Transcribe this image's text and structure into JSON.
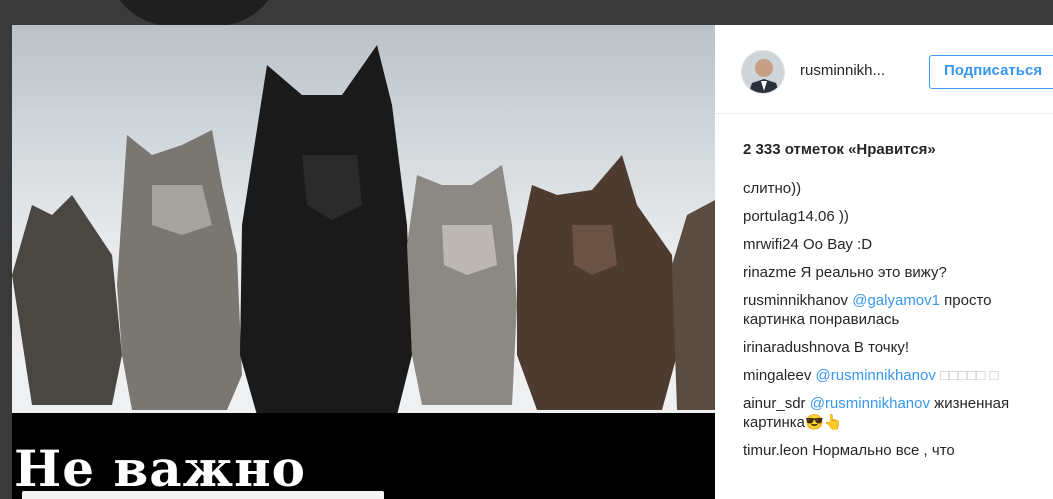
{
  "post": {
    "caption_overlay": "Не важно"
  },
  "header": {
    "username": "rusminnikh...",
    "follow_label": "Подписаться"
  },
  "likes_text": "2 333 отметок «Нравится»",
  "comments": [
    {
      "user": "",
      "text": "слитно))",
      "mention": ""
    },
    {
      "user": "portulag14.06",
      "text": " ))",
      "mention": ""
    },
    {
      "user": "mrwifi24",
      "text": " Оо Вау :D",
      "mention": ""
    },
    {
      "user": "rinazme",
      "text": " Я реально это вижу?",
      "mention": ""
    },
    {
      "user": "rusminnikhanov",
      "mention": " @galyamov1",
      "text": " просто картинка понравилась"
    },
    {
      "user": "irinaradushnova",
      "text": " В точку!",
      "mention": ""
    },
    {
      "user": "mingaleev",
      "mention": " @rusminnikhanov",
      "text": " □□□□□ □"
    },
    {
      "user": "ainur_sdr",
      "mention": " @rusminnikhanov",
      "text": " жизненная картинка😎👆"
    },
    {
      "user": "timur.leon",
      "text": " Нормально все , что",
      "mention": ""
    }
  ]
}
